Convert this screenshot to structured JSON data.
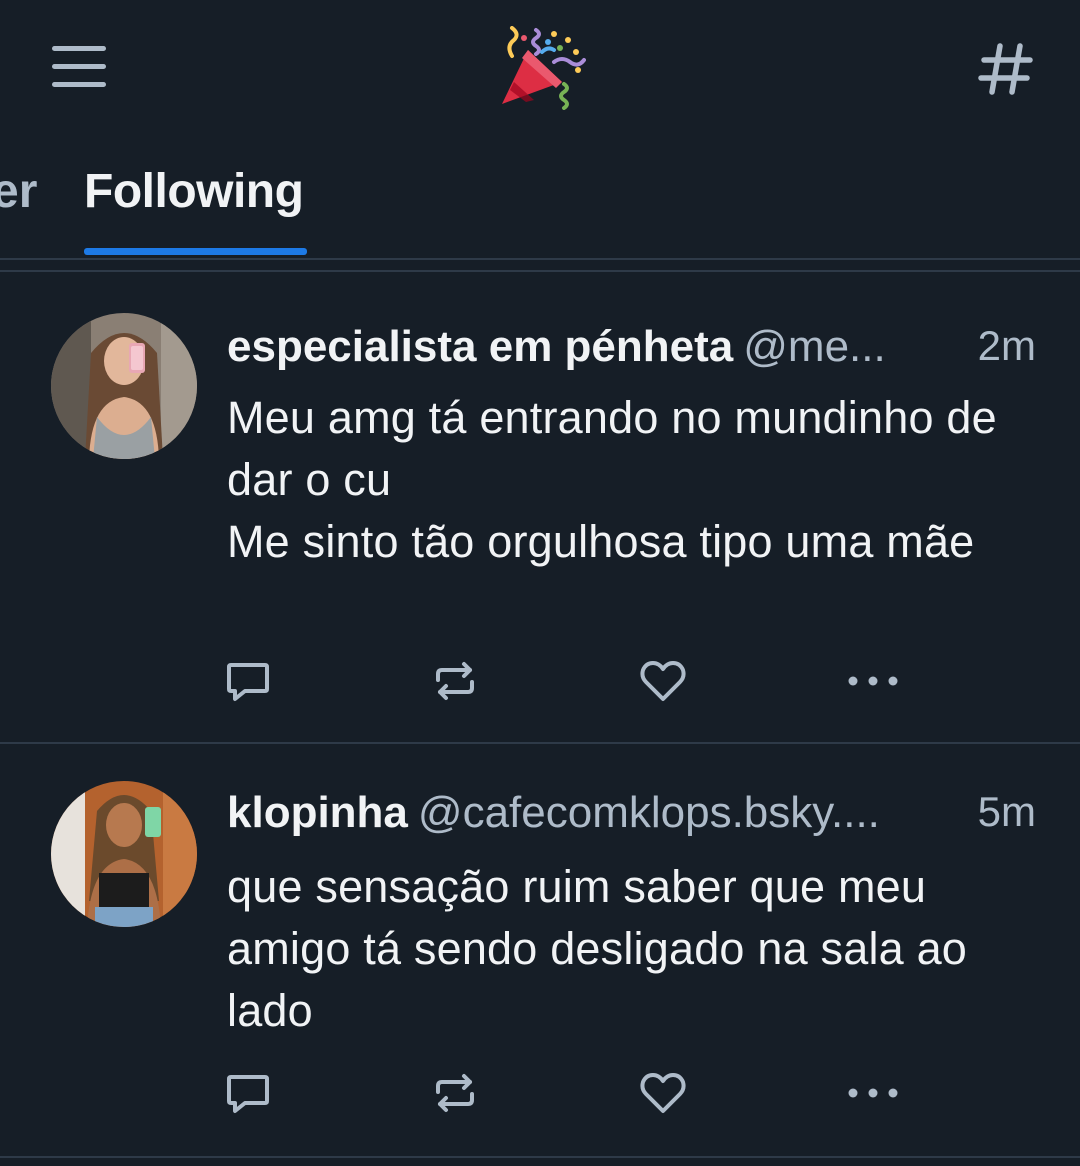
{
  "header": {
    "menu_icon": "hamburger-menu-icon",
    "logo_icon": "party-popper-icon",
    "feeds_icon": "hashtag-icon"
  },
  "tabs": [
    {
      "label": "er",
      "active": false
    },
    {
      "label": "Following",
      "active": true
    }
  ],
  "colors": {
    "background": "#161e27",
    "accent": "#1d7ae6",
    "text_primary": "#f1f3f5",
    "text_secondary": "#aebbc9",
    "divider": "#2e3a48"
  },
  "posts": [
    {
      "display_name": "especialista em pénheta",
      "handle": "@me...",
      "time": "2m",
      "text": "Meu amg tá entrando no mundinho de dar o cu\nMe sinto tão orgulhosa tipo uma mãe",
      "actions": [
        "reply-icon",
        "repost-icon",
        "like-icon",
        "more-icon"
      ]
    },
    {
      "display_name": "klopinha",
      "handle": "@cafecomklops.bsky....",
      "time": "5m",
      "text": "que sensação ruim saber que meu amigo tá sendo desligado na sala ao lado",
      "actions": [
        "reply-icon",
        "repost-icon",
        "like-icon",
        "more-icon"
      ]
    }
  ]
}
